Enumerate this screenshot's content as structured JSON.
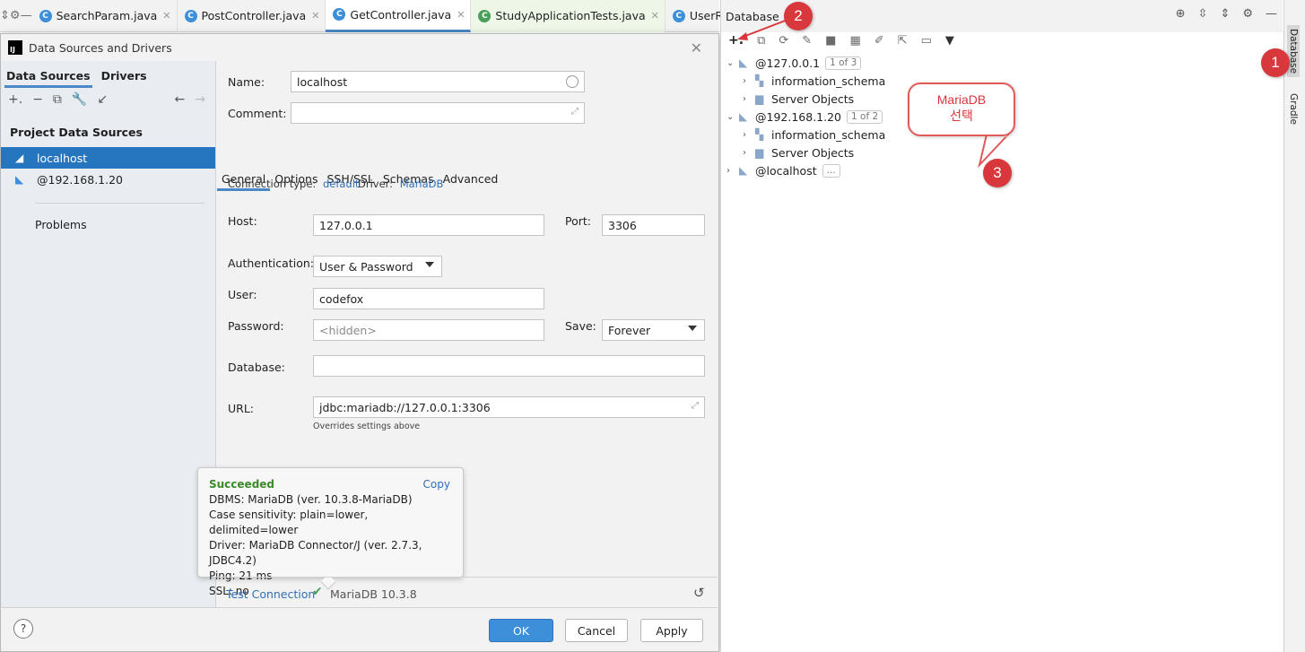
{
  "editor_tabs": [
    {
      "label": "SearchParam.java"
    },
    {
      "label": "PostController.java"
    },
    {
      "label": "GetController.java"
    },
    {
      "label": "StudyApplicationTests.java"
    },
    {
      "label": "UserRe"
    }
  ],
  "dialog": {
    "title": "Data Sources and Drivers",
    "left": {
      "tabs": [
        "Data Sources",
        "Drivers"
      ],
      "section": "Project Data Sources",
      "items": [
        "localhost",
        "@192.168.1.20"
      ],
      "problems": "Problems"
    },
    "form": {
      "name_label": "Name:",
      "name_value": "localhost",
      "comment_label": "Comment:",
      "tabs": [
        "General",
        "Options",
        "SSH/SSL",
        "Schemas",
        "Advanced"
      ],
      "conn_type_label": "Connection type:",
      "conn_type_value": "default",
      "driver_label": "Driver:",
      "driver_value": "MariaDB",
      "host_label": "Host:",
      "host_value": "127.0.0.1",
      "port_label": "Port:",
      "port_value": "3306",
      "auth_label": "Authentication:",
      "auth_value": "User & Password",
      "user_label": "User:",
      "user_value": "codefox",
      "password_label": "Password:",
      "password_placeholder": "<hidden>",
      "save_label": "Save:",
      "save_value": "Forever",
      "database_label": "Database:",
      "url_label": "URL:",
      "url_value": "jdbc:mariadb://127.0.0.1:3306",
      "url_hint": "Overrides settings above"
    },
    "popup": {
      "status": "Succeeded",
      "copy": "Copy",
      "lines": [
        "DBMS: MariaDB (ver. 10.3.8-MariaDB)",
        "Case sensitivity: plain=lower, delimited=lower",
        "Driver: MariaDB Connector/J (ver. 2.7.3, JDBC4.2)",
        "Ping: 21 ms",
        "SSL: no"
      ]
    },
    "test_connection": "Test Connection",
    "test_version": "MariaDB 10.3.8",
    "help": "?",
    "buttons": {
      "ok": "OK",
      "cancel": "Cancel",
      "apply": "Apply"
    }
  },
  "database_panel": {
    "title": "Database",
    "tree": [
      {
        "label": "@127.0.0.1",
        "badge": "1 of 3"
      },
      {
        "label": "information_schema"
      },
      {
        "label": "Server Objects"
      },
      {
        "label": "@192.168.1.20",
        "badge": "1 of 2"
      },
      {
        "label": "information_schema"
      },
      {
        "label": "Server Objects"
      },
      {
        "label": "@localhost",
        "badge": "..."
      }
    ]
  },
  "sidebar_tabs": [
    "Database",
    "Gradle"
  ],
  "annotations": {
    "marker1": "1",
    "marker2": "2",
    "marker3": "3",
    "callout_line1": "MariaDB",
    "callout_line2": "선택"
  },
  "colors": {
    "accent": "#3d8fd9",
    "selection": "#2675bf",
    "success": "#3a8a2a",
    "annotation": "#d8373b"
  }
}
